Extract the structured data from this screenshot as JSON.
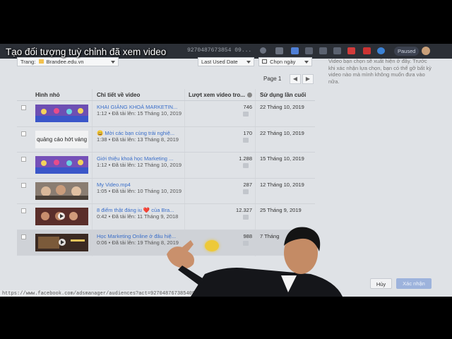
{
  "caption": "Tạo đối tượng tuỳ chỉnh đã xem video",
  "browser": {
    "url_fragment": "9270487673854 09...",
    "status_url": "https://www.facebook.com/adsmanager/audiences?act=927048767385409&busine...",
    "extension_badge": "Paused"
  },
  "filters": {
    "page_label": "Trang:",
    "page_value": "Brandee.edu.vn",
    "sort_value": "Last Used Date",
    "date_value": "Chọn ngày"
  },
  "pager": {
    "label": "Page 1",
    "prev": "◀",
    "next": "▶"
  },
  "table": {
    "headers": [
      "Hình nhỏ",
      "Chi tiết về video",
      "Lượt xem video tro...",
      "Sử dụng lần cuối"
    ],
    "rows": [
      {
        "thumb": "image",
        "title": "KHAI GIẢNG KHOÁ MARKETIN...",
        "meta": "1:12 • Đã tải lên: 15 Tháng 10, 2019",
        "views": "746",
        "last_used": "22 Tháng 10, 2019"
      },
      {
        "thumb": "text",
        "thumb_text": "quảng cáo hớt váng",
        "title": "😀 Mời các bạn cùng trải nghiệ...",
        "meta": "1:38 • Đã tải lên: 13 Tháng 8, 2019",
        "views": "170",
        "last_used": "22 Tháng 10, 2019"
      },
      {
        "thumb": "image",
        "title": "Giới thiệu khoá học Marketing ...",
        "meta": "1:12 • Đã tải lên: 12 Tháng 10, 2019",
        "views": "1.288",
        "last_used": "15 Tháng 10, 2019"
      },
      {
        "thumb": "image",
        "title": "My Video.mp4",
        "meta": "1:05 • Đã tải lên: 10 Tháng 10, 2019",
        "views": "287",
        "last_used": "12 Tháng 10, 2019"
      },
      {
        "thumb": "image",
        "title": "8 điểm thật đáng iu ❤️ của Bra...",
        "meta": "0:42 • Đã tải lên: 11 Tháng 9, 2018",
        "views": "12.327",
        "last_used": "25 Tháng 9, 2019"
      },
      {
        "thumb": "image",
        "title": "Học Marketing Online ở đâu hiệ...",
        "meta": "0:06 • Đã tải lên: 19 Tháng 8, 2019",
        "views": "988",
        "last_used": "7 Tháng"
      }
    ]
  },
  "side_text": "Video bạn chọn sẽ xuất hiện ở đây. Trước khi xác nhận lựa chọn, bạn có thể gỡ bất kỳ video nào mà mình không muốn đưa vào nữa.",
  "buttons": {
    "cancel": "Hủy",
    "confirm": "Xác nhận"
  },
  "colors": {
    "link": "#3b6fc9",
    "confirm_bg": "#9db3dc",
    "page_bg": "#dfe2e6"
  }
}
